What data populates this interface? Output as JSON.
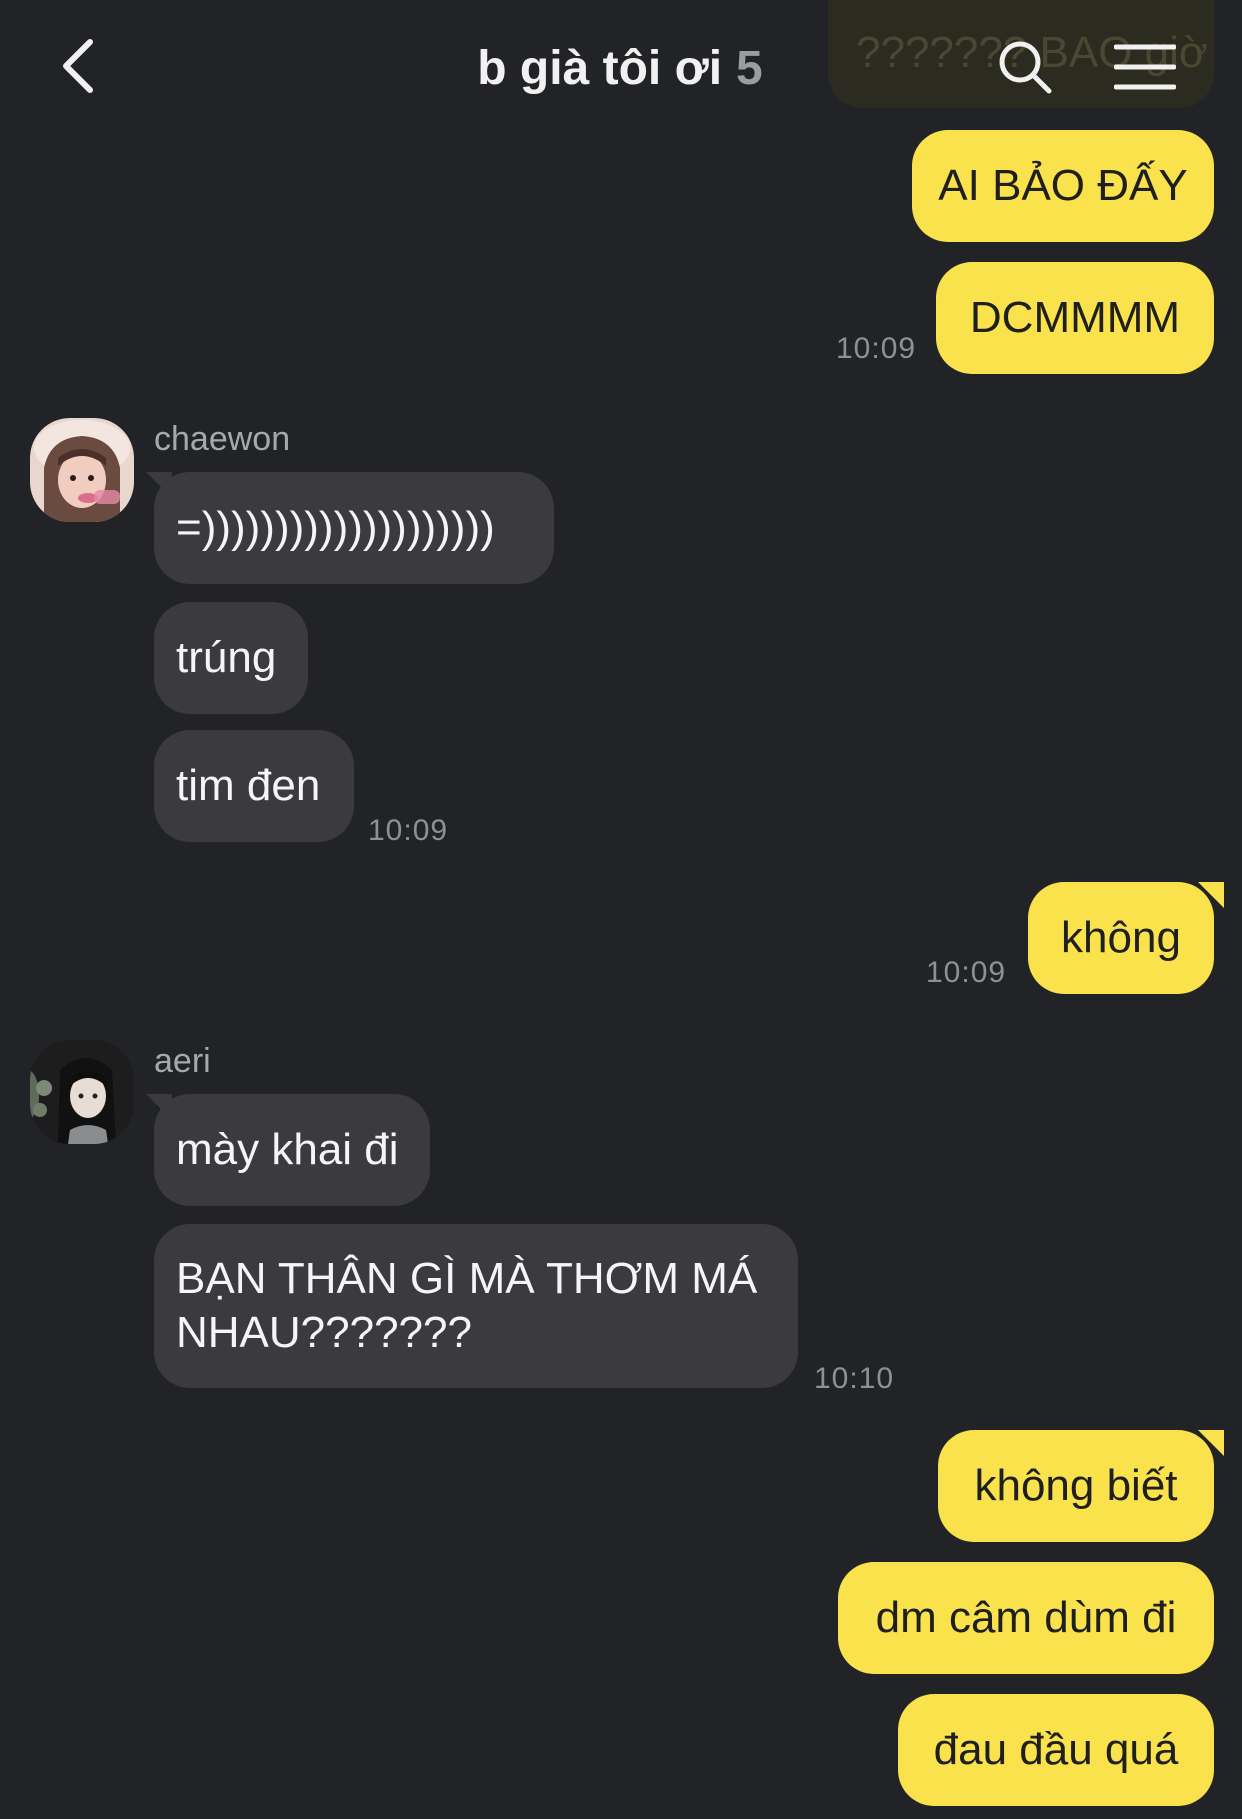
{
  "header": {
    "back_icon": "chevron-left-icon",
    "title": "b già tôi ơi",
    "member_count": "5",
    "search_icon": "search-icon",
    "menu_icon": "hamburger-menu-icon"
  },
  "colors": {
    "background": "#222326",
    "sent_bubble": "#f9e24b",
    "received_bubble": "#3b3b3f",
    "timestamp": "#8f9095"
  },
  "partial_message": {
    "text": "??????? BAO giờ"
  },
  "messages": [
    {
      "direction": "sent",
      "text": "AI BẢO ĐẤY"
    },
    {
      "direction": "sent",
      "text": "DCMMMM",
      "time": "10:09"
    },
    {
      "direction": "received",
      "sender": "chaewon",
      "text": "=))))))))))))))))))))"
    },
    {
      "direction": "received",
      "sender": "chaewon",
      "text": "trúng"
    },
    {
      "direction": "received",
      "sender": "chaewon",
      "text": "tim đen",
      "time": "10:09"
    },
    {
      "direction": "sent",
      "text": "không",
      "time": "10:09"
    },
    {
      "direction": "received",
      "sender": "aeri",
      "text": "mày khai đi"
    },
    {
      "direction": "received",
      "sender": "aeri",
      "text": "BẠN THÂN GÌ MÀ THƠM MÁ NHAU???????",
      "time": "10:10"
    },
    {
      "direction": "sent",
      "text": "không biết"
    },
    {
      "direction": "sent",
      "text": "dm câm dùm đi"
    },
    {
      "direction": "sent",
      "text": "đau đầu quá"
    }
  ]
}
